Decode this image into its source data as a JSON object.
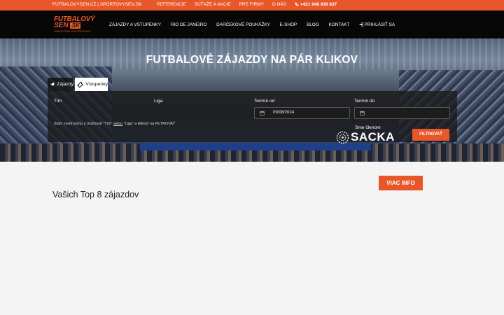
{
  "topbar": {
    "site1": "FUTBALOVYSEN.CZ",
    "separator": "|",
    "site2": "SPORTOVYSEN.SK",
    "links": [
      "REFERENCIE",
      "SÚŤAŽE A AKCIE",
      "PRE FIRMY",
      "O NÁS"
    ],
    "phone": "+421 948 938 837"
  },
  "logo": {
    "line1": "FUTBALOVÝ",
    "line2": "SEN",
    "tld": ".SK",
    "tagline": "VAŠA FUTBALOVÁ CESTOVKA"
  },
  "nav": {
    "items": [
      "ZÁJAZDY A VSTUPENKY",
      "RIO DE JANEIRO",
      "DARČEKOVÉ POUKÁŽKY",
      "E-SHOP",
      "BLOG",
      "KONTAKT"
    ],
    "login": "PRIHLÁSIŤ SA"
  },
  "hero": {
    "title": "FUTBALOVÉ ZÁJAZDY NA PÁR KLIKOV"
  },
  "tabs": {
    "trips": "Zájazdy",
    "tickets": "Vstupenky"
  },
  "filter": {
    "team_label": "Tím",
    "league_label": "Liga",
    "date_from_label": "Termín od",
    "date_from_value": "09/08/2024",
    "date_to_label": "Termín do",
    "date_to_value": "",
    "hint_prefix": "Stačí zvoliť jednu z možností \"Tím\"",
    "hint_or": "alebo",
    "hint_suffix": "\"Liga\" a kliknúť na FILTROVAŤ",
    "member_label": "Sme členom",
    "member_logo": "SACKA",
    "button": "FILTROVAŤ"
  },
  "main": {
    "more_button": "VIAC INFO",
    "section_title": "Vašich Top 8 zájazdov"
  },
  "colors": {
    "accent": "#e8572a",
    "navbar": "#070707"
  }
}
